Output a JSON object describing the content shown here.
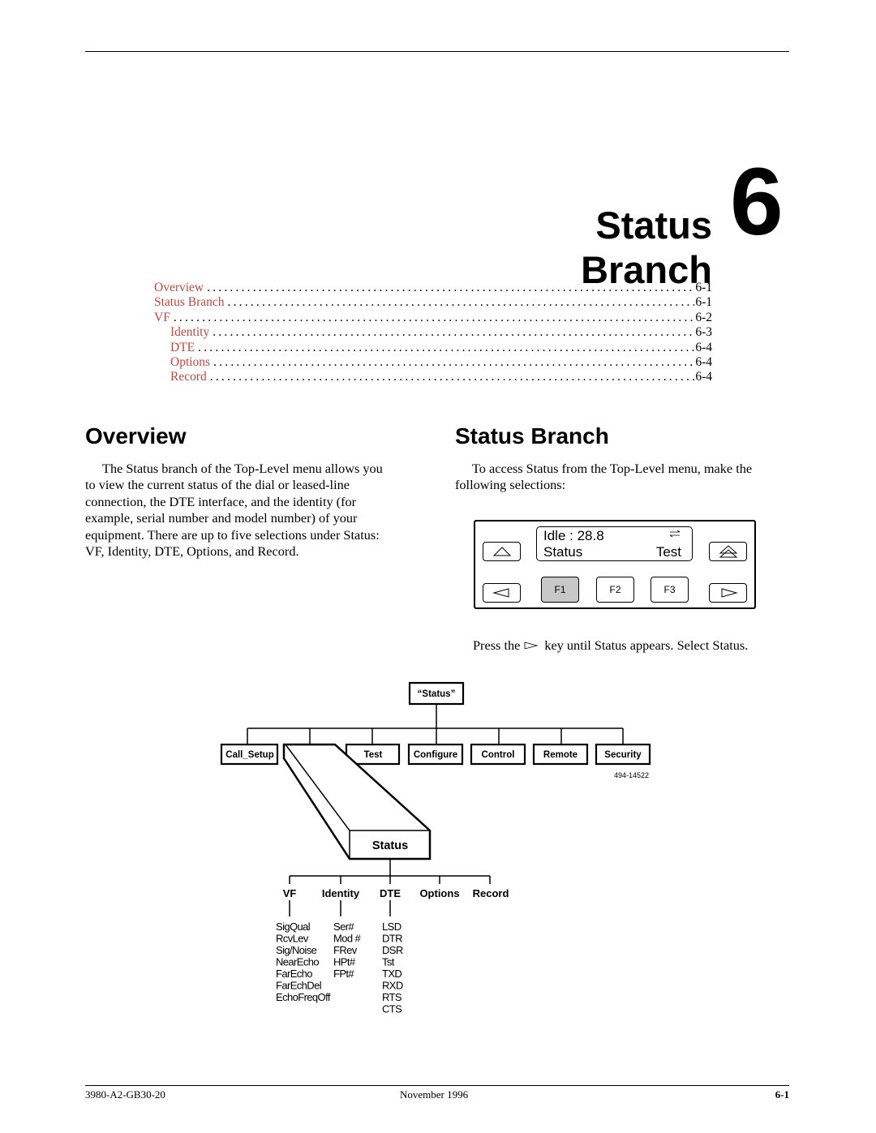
{
  "chapter": {
    "title": "Status Branch",
    "number": "6"
  },
  "toc": [
    {
      "label": "Overview",
      "page": "6-1",
      "level": 1
    },
    {
      "label": "Status Branch",
      "page": "6-1",
      "level": 1
    },
    {
      "label": "VF",
      "page": "6-2",
      "level": 1
    },
    {
      "label": "Identity",
      "page": "6-3",
      "level": 2
    },
    {
      "label": "DTE",
      "page": "6-4",
      "level": 2
    },
    {
      "label": "Options",
      "page": "6-4",
      "level": 2
    },
    {
      "label": "Record",
      "page": "6-4",
      "level": 2
    }
  ],
  "toc_color": "#c8463c",
  "overview": {
    "heading": "Overview",
    "lines": [
      "The Status branch of the Top-Level menu allows you",
      "to view the current status of the dial or leased-line",
      "connection, the DTE interface, and the identity (for",
      "example, serial number and model number) of your",
      "equipment. There are up to five selections under Status:",
      "VF, Identity, DTE, Options, and Record."
    ]
  },
  "status_branch": {
    "heading": "Status Branch",
    "lines": [
      "To access Status from the Top-Level menu, make the",
      "following selections:"
    ],
    "press_before": "Press the",
    "press_after": "key until Status appears. Select Status."
  },
  "lcd": {
    "line1": "Idle : 28.8",
    "line2_left": "Status",
    "line2_right": "Test",
    "keys": [
      "F1",
      "F2",
      "F3"
    ],
    "selected_key": "F1",
    "icons": [
      "up-arrow-icon",
      "left-arrow-icon",
      "top-menu-icon",
      "right-arrow-icon",
      "transmit-receive-icon"
    ]
  },
  "diagram": {
    "root": "“Status”",
    "branches": [
      "Call_Setup",
      "Test",
      "Configure",
      "Control",
      "Remote",
      "Security"
    ],
    "expanded": "Status",
    "figure_id": "494-14522",
    "children": [
      "VF",
      "Identity",
      "DTE",
      "Options",
      "Record"
    ],
    "vf_items": [
      "SigQual",
      "RcvLev",
      "Sig/Noise",
      "NearEcho",
      "FarEcho",
      "FarEchDel",
      "EchoFreqOff"
    ],
    "identity_items": [
      "Ser#",
      "Mod #",
      "FRev",
      "HPt#",
      "FPt#"
    ],
    "dte_items": [
      "LSD",
      "DTR",
      "DSR",
      "Tst",
      "TXD",
      "RXD",
      "RTS",
      "CTS"
    ]
  },
  "footer": {
    "doc_number": "3980-A2-GB30-20",
    "date": "November 1996",
    "page": "6-1"
  }
}
